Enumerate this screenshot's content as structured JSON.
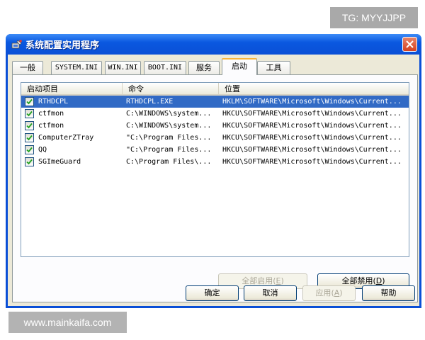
{
  "watermarks": {
    "top": "TG: MYYJJPP",
    "bottom": "www.mainkaifa.com"
  },
  "window": {
    "title": "系统配置实用程序"
  },
  "tabs": [
    {
      "label": "一般"
    },
    {
      "label": "SYSTEM.INI"
    },
    {
      "label": "WIN.INI"
    },
    {
      "label": "BOOT.INI"
    },
    {
      "label": "服务"
    },
    {
      "label": "启动",
      "active": true
    },
    {
      "label": "工具"
    }
  ],
  "startup_list": {
    "columns": [
      "启动项目",
      "命令",
      "位置"
    ],
    "rows": [
      {
        "name": "RTHDCPL",
        "command": "RTHDCPL.EXE",
        "location": "HKLM\\SOFTWARE\\Microsoft\\Windows\\Current...",
        "checked": true,
        "selected": true
      },
      {
        "name": "ctfmon",
        "command": "C:\\WINDOWS\\system...",
        "location": "HKCU\\SOFTWARE\\Microsoft\\Windows\\Current...",
        "checked": true
      },
      {
        "name": "ctfmon",
        "command": "C:\\WINDOWS\\system...",
        "location": "HKCU\\SOFTWARE\\Microsoft\\Windows\\Current...",
        "checked": true
      },
      {
        "name": "ComputerZTray",
        "command": "\"C:\\Program Files...",
        "location": "HKCU\\SOFTWARE\\Microsoft\\Windows\\Current...",
        "checked": true
      },
      {
        "name": "QQ",
        "command": "\"C:\\Program Files...",
        "location": "HKCU\\SOFTWARE\\Microsoft\\Windows\\Current...",
        "checked": true
      },
      {
        "name": "SGImeGuard",
        "command": "C:\\Program Files\\...",
        "location": "HKCU\\SOFTWARE\\Microsoft\\Windows\\Current...",
        "checked": true
      }
    ]
  },
  "buttons": {
    "enable_all": {
      "label": "全部启用",
      "key": "E"
    },
    "disable_all": {
      "label": "全部禁用",
      "key": "D"
    },
    "ok": "确定",
    "cancel": "取消",
    "apply": {
      "label": "应用",
      "key": "A"
    },
    "help": "帮助"
  },
  "colors": {
    "title_bar": "#0a4fd6",
    "selection": "#316ac5",
    "tab_highlight": "#f8b33a",
    "close_button": "#d6401f"
  }
}
